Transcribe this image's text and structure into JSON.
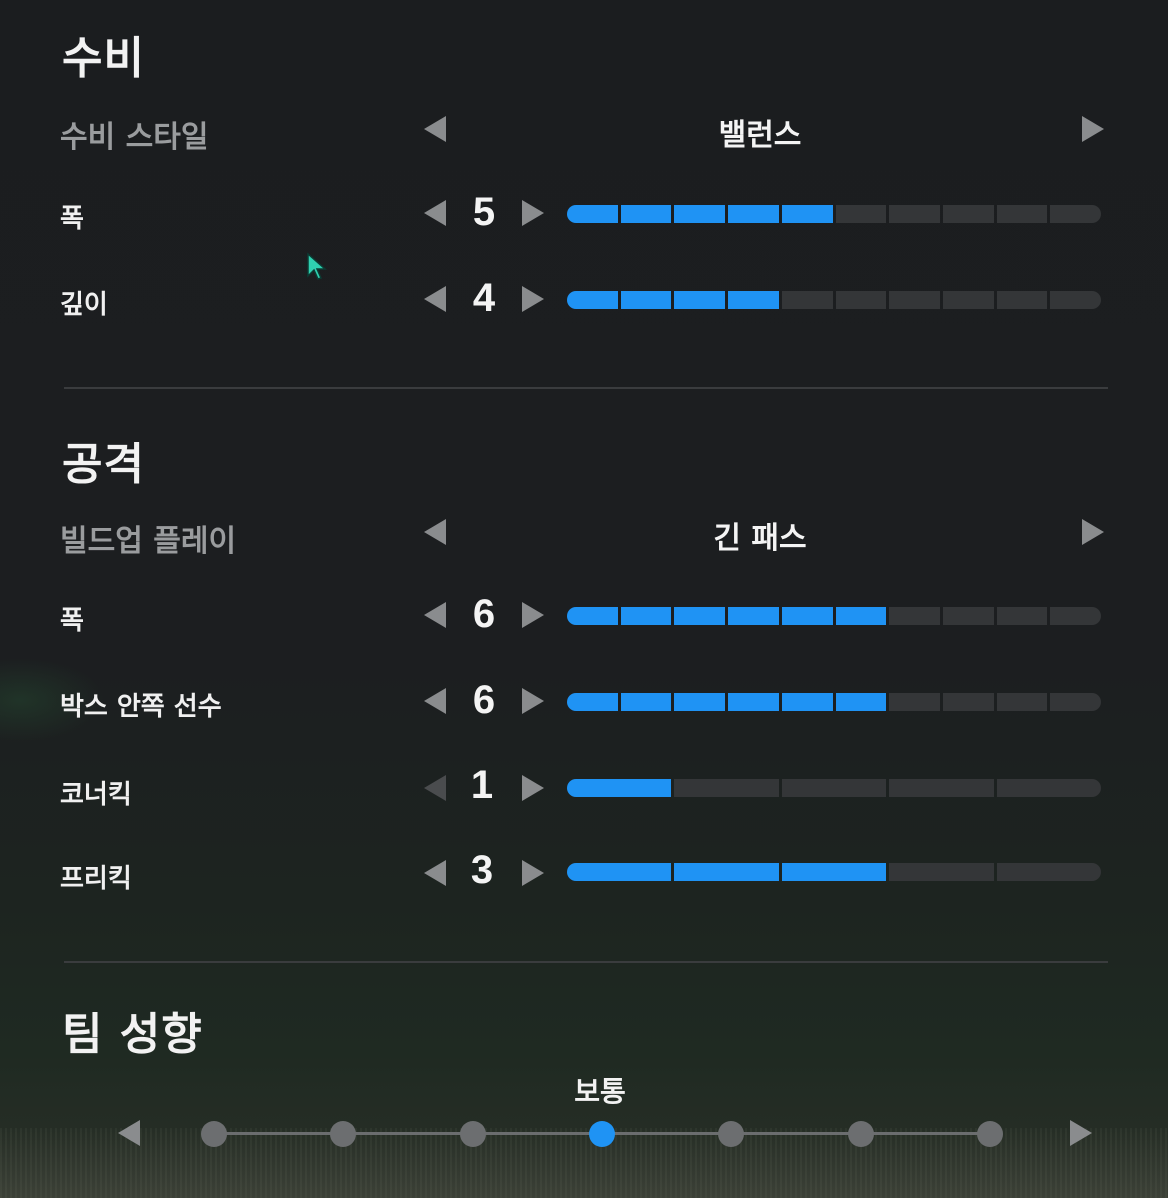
{
  "defense": {
    "title": "수비",
    "style_label": "수비 스타일",
    "style_value": "밸런스",
    "rows": [
      {
        "label": "폭",
        "value": "5",
        "level": 5,
        "max": 10
      },
      {
        "label": "깊이",
        "value": "4",
        "level": 4,
        "max": 10
      }
    ]
  },
  "attack": {
    "title": "공격",
    "style_label": "빌드업 플레이",
    "style_value": "긴 패스",
    "rows": [
      {
        "label": "폭",
        "value": "6",
        "level": 6,
        "max": 10
      },
      {
        "label": "박스 안쪽 선수",
        "value": "6",
        "level": 6,
        "max": 10
      },
      {
        "label": "코너킥",
        "value": "1",
        "level": 1,
        "max": 5
      },
      {
        "label": "프리킥",
        "value": "3",
        "level": 3,
        "max": 5
      }
    ]
  },
  "team": {
    "title": "팀 성향",
    "selected_label": "보통",
    "positions": 7,
    "selected_index": 3
  },
  "colors": {
    "accent": "#1f93f4",
    "inactive_segment": "#343638",
    "arrow": "#8a8c8e"
  },
  "icons": [
    "arrow-left-icon",
    "arrow-right-icon",
    "cursor-icon"
  ]
}
